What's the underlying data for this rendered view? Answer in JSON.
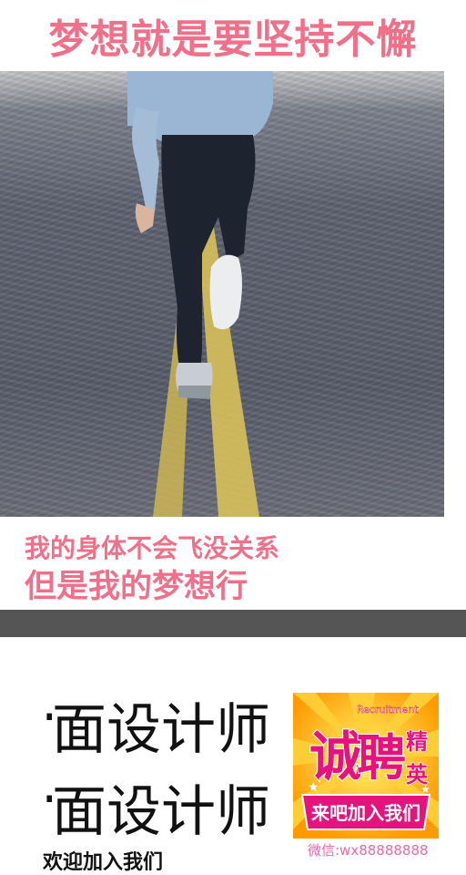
{
  "header": {
    "title": "梦想就是要坚持不懈"
  },
  "hero": {
    "image_description_icon": "running-person-on-road-photo"
  },
  "captions": {
    "line1": "我的身体不会飞没关系",
    "line2": "但是我的梦想行"
  },
  "job": {
    "title_line1": "面设计师",
    "title_line2": "面设计师",
    "welcome": "欢迎加入我们"
  },
  "poster": {
    "recruitment": "Recruitment",
    "big_text_1": "诚",
    "big_text_2": "聘",
    "side_text_1": "精",
    "side_text_2": "英",
    "banner": "来吧加入我们"
  },
  "contact": {
    "wechat": "微信:wx88888888"
  },
  "colors": {
    "accent_pink": "#f0708a",
    "divider_gray": "#555555",
    "poster_yellow": "#ffb400",
    "poster_magenta": "#e6137f"
  }
}
